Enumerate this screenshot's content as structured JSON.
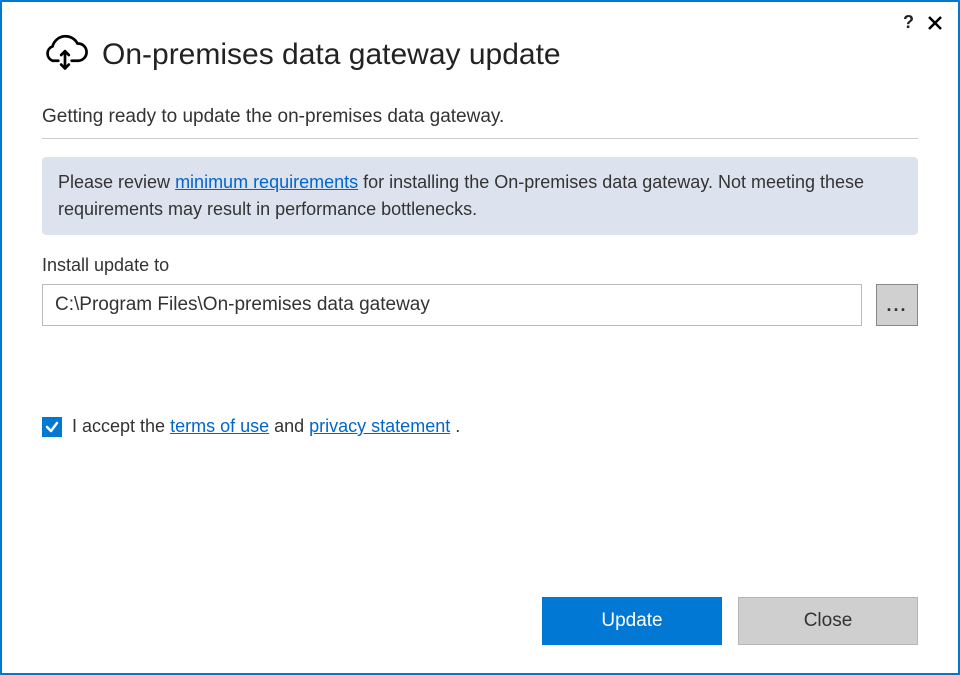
{
  "titlebar": {
    "help_glyph": "?"
  },
  "header": {
    "title": "On-premises data gateway update"
  },
  "main": {
    "intro": "Getting ready to update the on-premises data gateway.",
    "info_prefix": "Please review ",
    "info_link": "minimum requirements",
    "info_suffix": " for installing the On-premises data gateway. Not meeting these requirements may result in performance bottlenecks.",
    "install_label": "Install update to",
    "install_path": "C:\\Program Files\\On-premises data gateway",
    "browse_label": "...",
    "accept_prefix": "I accept the ",
    "terms_link": "terms of use",
    "accept_mid": " and ",
    "privacy_link": "privacy statement",
    "accept_suffix": " .",
    "accept_checked": true
  },
  "buttons": {
    "update": "Update",
    "close": "Close"
  }
}
